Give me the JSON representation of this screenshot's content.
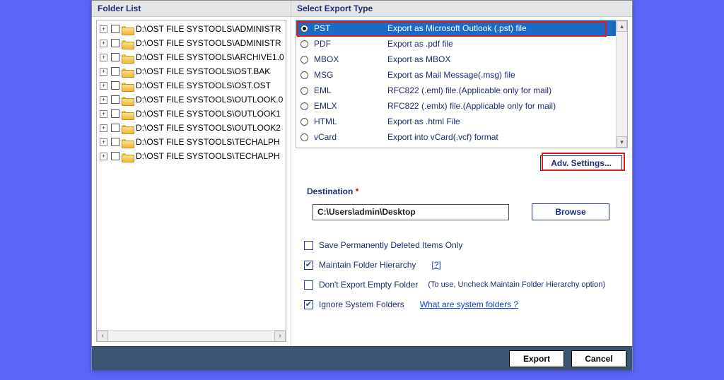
{
  "left": {
    "header": "Folder List",
    "items": [
      "D:\\OST FILE SYSTOOLS\\ADMINISTR",
      "D:\\OST FILE SYSTOOLS\\ADMINISTR",
      "D:\\OST FILE SYSTOOLS\\ARCHIVE1.0",
      "D:\\OST FILE SYSTOOLS\\OST.BAK",
      "D:\\OST FILE SYSTOOLS\\OST.OST",
      "D:\\OST FILE SYSTOOLS\\OUTLOOK.0",
      "D:\\OST FILE SYSTOOLS\\OUTLOOK1",
      "D:\\OST FILE SYSTOOLS\\OUTLOOK2",
      "D:\\OST FILE SYSTOOLS\\TECHALPH",
      "D:\\OST FILE SYSTOOLS\\TECHALPH"
    ]
  },
  "right": {
    "header": "Select Export Type",
    "formats": [
      {
        "name": "PST",
        "desc": "Export as Microsoft Outlook (.pst) file",
        "selected": true
      },
      {
        "name": "PDF",
        "desc": "Export as .pdf file"
      },
      {
        "name": "MBOX",
        "desc": "Export as MBOX"
      },
      {
        "name": "MSG",
        "desc": "Export as Mail Message(.msg) file"
      },
      {
        "name": "EML",
        "desc": "RFC822 (.eml) file.(Applicable only for mail)"
      },
      {
        "name": "EMLX",
        "desc": "RFC822 (.emlx) file.(Applicable only for mail)"
      },
      {
        "name": "HTML",
        "desc": "Export as .html File"
      },
      {
        "name": "vCard",
        "desc": "Export into vCard(.vcf) format"
      }
    ],
    "adv_settings": "Adv. Settings...",
    "destination_label": "Destination",
    "destination_value": "C:\\Users\\admin\\Desktop",
    "browse": "Browse",
    "opts": {
      "save_deleted": "Save Permanently Deleted Items Only",
      "maintain_hierarchy": "Maintain Folder Hierarchy",
      "hierarchy_help": "[?]",
      "no_empty": "Don't Export Empty Folder",
      "no_empty_hint": "(To use, Uncheck Maintain Folder Hierarchy option)",
      "ignore_system": "Ignore System Folders",
      "system_help": "What are system folders ?"
    }
  },
  "footer": {
    "export": "Export",
    "cancel": "Cancel"
  }
}
